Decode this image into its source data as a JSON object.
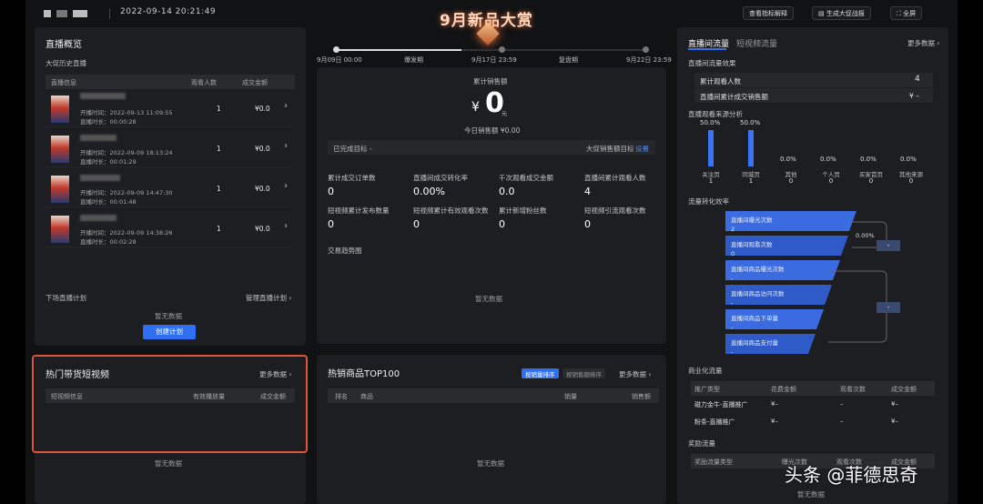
{
  "header": {
    "datetime": "2022-09-14 20:21:49",
    "banner_title": "9月新品大赏",
    "btn_indicator": "查看指标解释",
    "btn_report": "生成大促战报",
    "btn_fullscreen": "全屏"
  },
  "timeline": {
    "points": [
      "9月09日 00:00",
      "9月17日 23:59",
      "9月22日 23:59"
    ],
    "phases": [
      "爆发期",
      "复盘期"
    ]
  },
  "overview": {
    "title": "直播概览",
    "history_label": "大促历史直播",
    "columns": [
      "直播信息",
      "观看人数",
      "成交金额"
    ],
    "rows": [
      {
        "start": "开播时间：2022-09-13 11:09:55",
        "duration": "直播时长：00:00:28",
        "viewers": "1",
        "amount": "¥0.0"
      },
      {
        "start": "开播时间：2022-09-09 18:13:24",
        "duration": "直播时长：00:01:29",
        "viewers": "1",
        "amount": "¥0.0"
      },
      {
        "start": "开播时间：2022-09-09 14:47:30",
        "duration": "直播时长：00:01:48",
        "viewers": "1",
        "amount": "¥0.0"
      },
      {
        "start": "开播时间：2022-09-09 14:38:26",
        "duration": "直播时长：00:02:28",
        "viewers": "1",
        "amount": "¥0.0"
      }
    ],
    "plan_label": "下场直播计划",
    "manage_plan": "管理直播计划 ›",
    "no_data": "暂无数据",
    "create_plan": "创建计划"
  },
  "hot_video": {
    "title": "热门带货短视频",
    "more": "更多数据 ›",
    "columns": [
      "短视频信息",
      "有效播放量",
      "成交金额"
    ],
    "no_data": "暂无数据"
  },
  "sales": {
    "label": "累计销售额",
    "currency": "¥",
    "value": "0",
    "unit": "元",
    "today": "今日销售额 ¥0.00",
    "target_done": "已完成目标 -",
    "target_label": "大促销售额目标",
    "target_set": "设置",
    "metrics": [
      {
        "label": "累计成交订单数",
        "value": "0"
      },
      {
        "label": "直播间成交转化率",
        "value": "0.00%"
      },
      {
        "label": "千次观看成交金额",
        "value": "0.0"
      },
      {
        "label": "直播间累计观看人数",
        "value": "4"
      },
      {
        "label": "短视频累计发布数量",
        "value": "0"
      },
      {
        "label": "短视频累计有效观看次数",
        "value": "0"
      },
      {
        "label": "累计新增粉丝数",
        "value": "0"
      },
      {
        "label": "短视频引流观看次数",
        "value": "0"
      }
    ],
    "trend_title": "交易趋势图",
    "no_data": "暂无数据"
  },
  "top100": {
    "title": "热销商品TOP100",
    "sort_volume": "按销量排序",
    "sort_amount": "按销售额排序",
    "more": "更多数据 ›",
    "columns": [
      "排名",
      "商品",
      "销量",
      "销售额"
    ],
    "no_data": "暂无数据"
  },
  "traffic": {
    "tab_live": "直播间流量",
    "tab_video": "短视频流量",
    "more": "更多数据 ›",
    "effect_title": "直播间流量效果",
    "kv": [
      {
        "label": "累计观看人数",
        "value": "4"
      },
      {
        "label": "直播间累计成交销售额",
        "value": "¥ –"
      }
    ],
    "source_title": "直播观看来源分析",
    "sources": [
      {
        "name": "关注页",
        "pct": "50.0%",
        "num": "1",
        "share": 0.5
      },
      {
        "name": "同城页",
        "pct": "50.0%",
        "num": "1",
        "share": 0.5
      },
      {
        "name": "其他",
        "pct": "0.0%",
        "num": "0",
        "share": 0
      },
      {
        "name": "个人页",
        "pct": "0.0%",
        "num": "0",
        "share": 0
      },
      {
        "name": "买家首页",
        "pct": "0.0%",
        "num": "0",
        "share": 0
      },
      {
        "name": "其他来源",
        "pct": "0.0%",
        "num": "0",
        "share": 0
      }
    ],
    "funnel_title": "流量转化效率",
    "funnel": [
      {
        "label": "直播间曝光次数",
        "value": "2"
      },
      {
        "label": "直播间观看次数",
        "value": "0"
      },
      {
        "label": "直播间商品曝光次数",
        "value": "-"
      },
      {
        "label": "直播间商品访问次数",
        "value": "-"
      },
      {
        "label": "直播间商品下单量",
        "value": "-"
      },
      {
        "label": "直播间商品支付量",
        "value": "-"
      }
    ],
    "funnel_rate": "0.00%",
    "funnel_box_1": "-",
    "funnel_box_2": "-",
    "biz_title": "商业化流量",
    "biz_columns": [
      "推广类型",
      "花费金额",
      "观看次数",
      "成交金额"
    ],
    "biz_rows": [
      {
        "type": "磁力金牛-直播推广",
        "cost": "¥–",
        "views": "–",
        "amount": "¥–"
      },
      {
        "type": "粉条-直播推广",
        "cost": "¥–",
        "views": "–",
        "amount": "¥–"
      }
    ],
    "reward_title": "奖励流量",
    "reward_columns": [
      "奖励流量类型",
      "曝光次数",
      "观看次数",
      "成交金额"
    ],
    "no_data": "暂无数据"
  },
  "watermark": "头条 @菲德思奇"
}
